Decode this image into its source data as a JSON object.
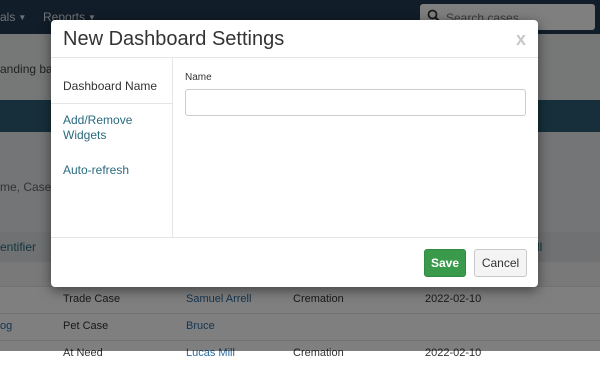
{
  "app": {
    "nav": {
      "item1_label": "als",
      "item2_label": "Reports"
    },
    "search": {
      "placeholder": "Search cases"
    },
    "strip1_partial": "anding ba",
    "strip2_partial": "me, Case N",
    "table": {
      "headers": {
        "h1": "entifier",
        "h2": "ll"
      },
      "rows": [
        {
          "c1": "",
          "c2": "Trade Case",
          "c3": "Samuel Arrell",
          "c4": "Cremation",
          "c5": "2022-02-10"
        },
        {
          "c1": "og",
          "c2": "Pet Case",
          "c3": "Bruce",
          "c4": "",
          "c5": ""
        },
        {
          "c1": "",
          "c2": "At Need",
          "c3": "Lucas Mill",
          "c4": "Cremation",
          "c5": "2022-02-10"
        }
      ]
    }
  },
  "modal": {
    "title": "New Dashboard Settings",
    "close_symbol": "x",
    "nav": [
      {
        "label": "Dashboard Name",
        "active": true
      },
      {
        "label": "Add/Remove Widgets",
        "active": false
      },
      {
        "label": "Auto-refresh",
        "active": false
      }
    ],
    "content": {
      "name_label": "Name",
      "name_value": ""
    },
    "footer": {
      "save_label": "Save",
      "cancel_label": "Cancel"
    }
  },
  "colors": {
    "navbar": "#233a52",
    "banner": "#2f5f77",
    "link": "#2a6a7e",
    "save_button": "#3a9a4b"
  }
}
